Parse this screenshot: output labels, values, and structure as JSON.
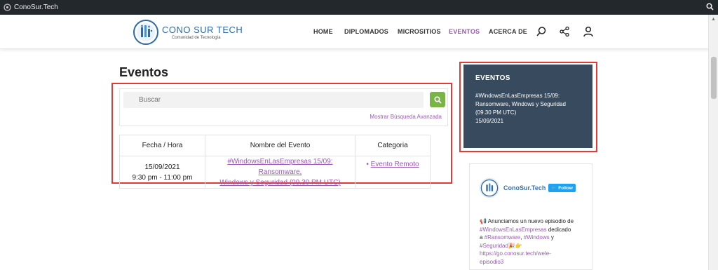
{
  "admin_bar": {
    "site_name": "ConoSur.Tech"
  },
  "brand": {
    "name": "CONO SUR TECH",
    "tagline": "Comunidad de Tecnología"
  },
  "nav": {
    "items": [
      {
        "label": "HOME"
      },
      {
        "label": "DIPLOMADOS"
      },
      {
        "label": "MICROSITIOS"
      },
      {
        "label": "EVENTOS"
      },
      {
        "label": "ACERCA DE"
      }
    ]
  },
  "page": {
    "title": "Eventos"
  },
  "search": {
    "placeholder": "Buscar",
    "advanced_label": "Mostrar Búsqueda Avanzada"
  },
  "events_table": {
    "headers": [
      "Fecha / Hora",
      "Nombre del Evento",
      "Categoria"
    ],
    "rows": [
      {
        "date": "15/09/2021",
        "time": "9:30 pm - 11:00 pm",
        "name_line1": "#WindowsEnLasEmpresas 15/09: Ransomware,",
        "name_line2": "Windows y Seguridad (09.30 PM UTC)",
        "category": "Evento Remoto"
      }
    ]
  },
  "sidebar_widget": {
    "title": "EVENTOS",
    "event_line1": "#WindowsEnLasEmpresas 15/09:",
    "event_line2": "Ransomware, Windows y Seguridad",
    "event_line3": "(09.30 PM UTC)",
    "event_date": "15/09/2021"
  },
  "twitter": {
    "account": "ConoSur.Tech",
    "follow_label": "Follow",
    "t1": "Anunciamos un nuevo episodio de",
    "t2": "#WindowsEnLasEmpresas",
    "t3": " dedicado",
    "t4": "a ",
    "t5": "#Ransomware",
    "t6": ", ",
    "t7": "#Windows",
    "t8": " y",
    "t9": "#Seguridad",
    "t10": "https://go.conosur.tech/wele-",
    "t11": "episodio3"
  },
  "colors": {
    "accent": "#9b59b6",
    "widget_bg": "#374a5e",
    "search_button": "#78b544",
    "highlight_box": "#e53935"
  }
}
